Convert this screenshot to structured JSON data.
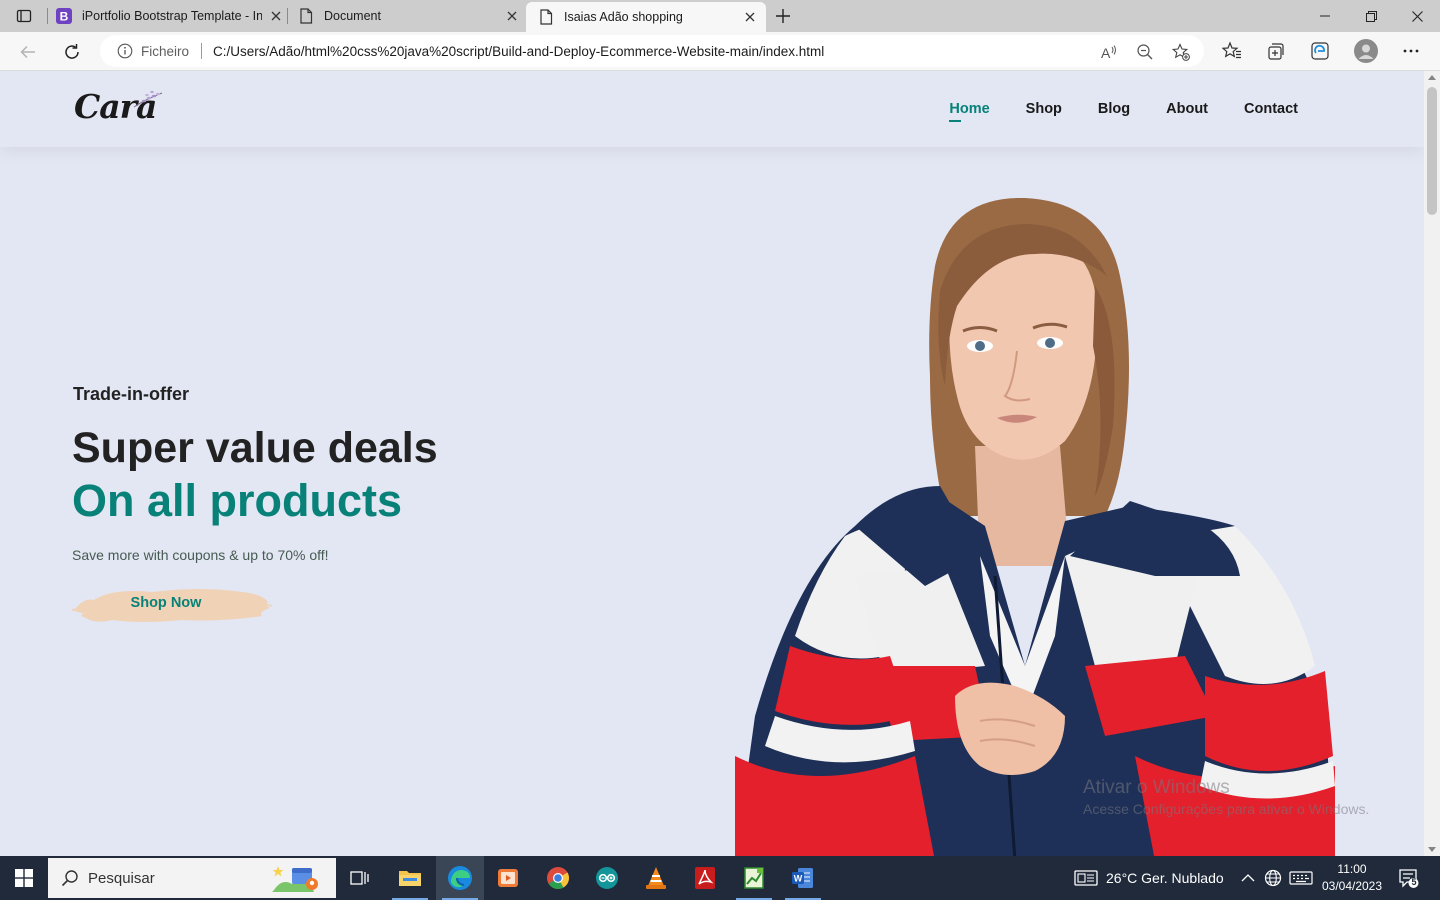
{
  "browser": {
    "tabs": [
      {
        "title": "iPortfolio Bootstrap Template - In",
        "favicon": "bootstrap-icon"
      },
      {
        "title": "Document",
        "favicon": "page-icon"
      },
      {
        "title": "Isaias Adão shopping",
        "favicon": "page-icon",
        "active": true
      }
    ],
    "address": {
      "scheme_label": "Ficheiro",
      "url": "C:/Users/Adão/html%20css%20java%20script/Build-and-Deploy-Ecommerce-Website-main/index.html"
    }
  },
  "site": {
    "logo_text": "Cara",
    "nav": [
      {
        "label": "Home",
        "active": true
      },
      {
        "label": "Shop"
      },
      {
        "label": "Blog"
      },
      {
        "label": "About"
      },
      {
        "label": "Contact"
      }
    ],
    "hero": {
      "kicker": "Trade-in-offer",
      "headline": "Super value deals",
      "headline_accent": "On all products",
      "subtitle": "Save more with coupons & up to 70% off!",
      "cta_label": "Shop Now"
    },
    "colors": {
      "background": "#e3e6f3",
      "accent": "#088178",
      "button_brush": "#f0d2b6"
    }
  },
  "watermark": {
    "line1": "Ativar o Windows",
    "line2": "Acesse Configurações para ativar o Windows."
  },
  "taskbar": {
    "search_placeholder": "Pesquisar",
    "weather": "26°C  Ger. Nublado",
    "time": "11:00",
    "date": "03/04/2023",
    "notifications": "5"
  }
}
